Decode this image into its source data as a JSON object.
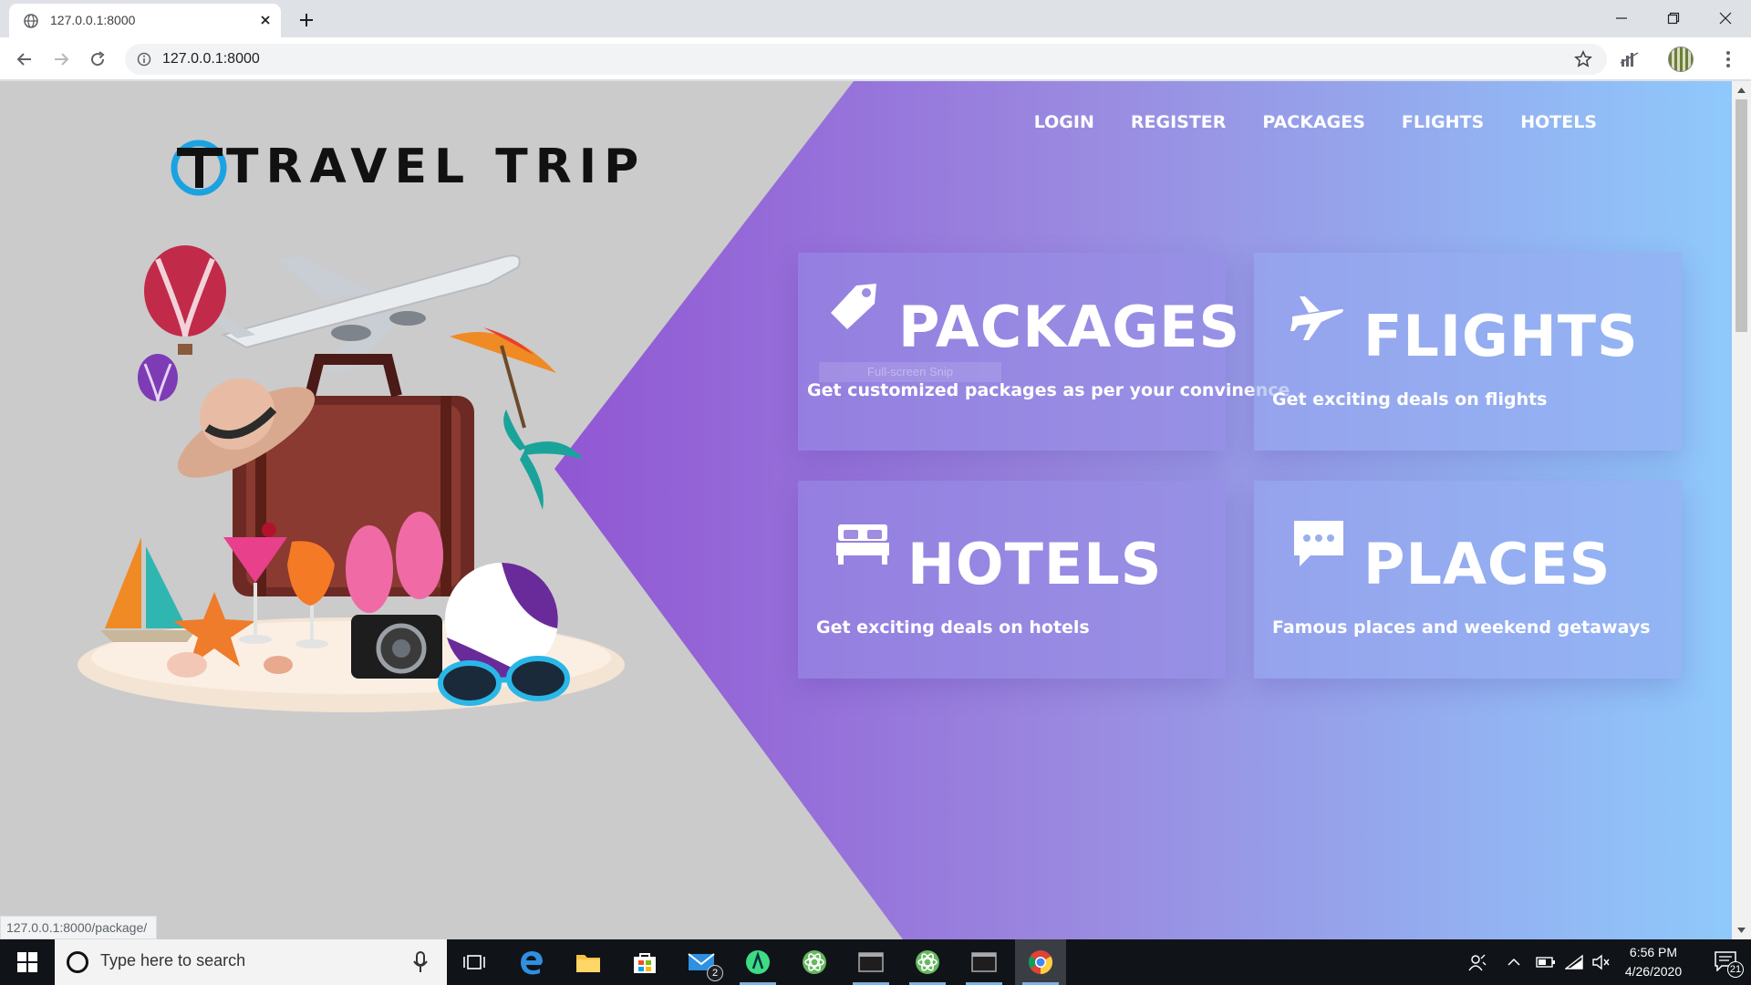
{
  "browser": {
    "tab_title": "127.0.0.1:8000",
    "url": "127.0.0.1:8000",
    "status_url": "127.0.0.1:8000/package/"
  },
  "site": {
    "logo_text": "TRAVEL TRIP",
    "nav": [
      "LOGIN",
      "REGISTER",
      "PACKAGES",
      "FLIGHTS",
      "HOTELS"
    ],
    "cards": [
      {
        "title": "PACKAGES",
        "desc": "Get customized packages as per your convinence",
        "icon": "tag-icon"
      },
      {
        "title": "FLIGHTS",
        "desc": "Get exciting deals on flights",
        "icon": "airplane-icon"
      },
      {
        "title": "HOTELS",
        "desc": "Get exciting deals on hotels",
        "icon": "bed-icon"
      },
      {
        "title": "PLACES",
        "desc": "Famous places and weekend getaways",
        "icon": "chat-icon"
      }
    ],
    "snip_tooltip": "Full-screen Snip"
  },
  "taskbar": {
    "search_placeholder": "Type here to search",
    "time": "6:56 PM",
    "date": "4/26/2020",
    "mail_badge": "2",
    "notification_count": "21"
  },
  "colors": {
    "accent_purple": "#9a62d8",
    "accent_blue": "#8ec8fb",
    "page_gray": "#cbcbcb"
  }
}
